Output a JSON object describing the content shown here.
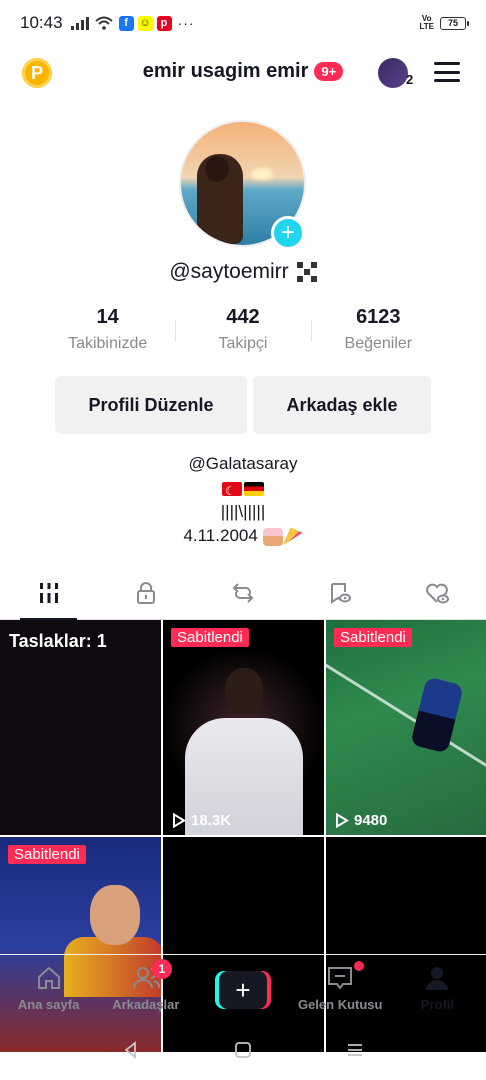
{
  "status_bar": {
    "time": "10:43",
    "dots": "···",
    "volte": "Vo\nLTE",
    "battery": "75"
  },
  "header": {
    "title": "emir usagim emir",
    "badge": "9+",
    "account_count": "2"
  },
  "profile": {
    "handle": "@saytoemirr",
    "stats": [
      {
        "value": "14",
        "label": "Takibinizde"
      },
      {
        "value": "442",
        "label": "Takipçi"
      },
      {
        "value": "6123",
        "label": "Beğeniler"
      }
    ],
    "buttons": {
      "edit": "Profili Düzenle",
      "add_friend": "Arkadaş ekle"
    },
    "bio": {
      "line1": "@Galatasaray",
      "line3": "||||\\|||||",
      "birthday": "4.11.2004"
    }
  },
  "tabs": [
    {
      "icon": "videos-grid-icon",
      "active": true
    },
    {
      "icon": "lock-icon",
      "active": false
    },
    {
      "icon": "repost-icon",
      "active": false
    },
    {
      "icon": "favorites-icon",
      "active": false
    },
    {
      "icon": "liked-icon",
      "active": false
    }
  ],
  "grid": {
    "draft_label": "Taslaklar: 1",
    "pinned_label": "Sabitlendi",
    "videos": [
      {
        "views": "18.3K"
      },
      {
        "views": "9480"
      }
    ]
  },
  "bottom_nav": [
    {
      "label": "Ana sayfa",
      "icon": "home-icon"
    },
    {
      "label": "Arkadaşlar",
      "icon": "friends-icon",
      "badge": "1"
    },
    {
      "label": "",
      "icon": "create-icon"
    },
    {
      "label": "Gelen Kutusu",
      "icon": "inbox-icon"
    },
    {
      "label": "Profil",
      "icon": "profile-icon"
    }
  ],
  "colors": {
    "accent": "#fe2c55",
    "cyan": "#20d5ec",
    "coin": "#fbb400"
  }
}
